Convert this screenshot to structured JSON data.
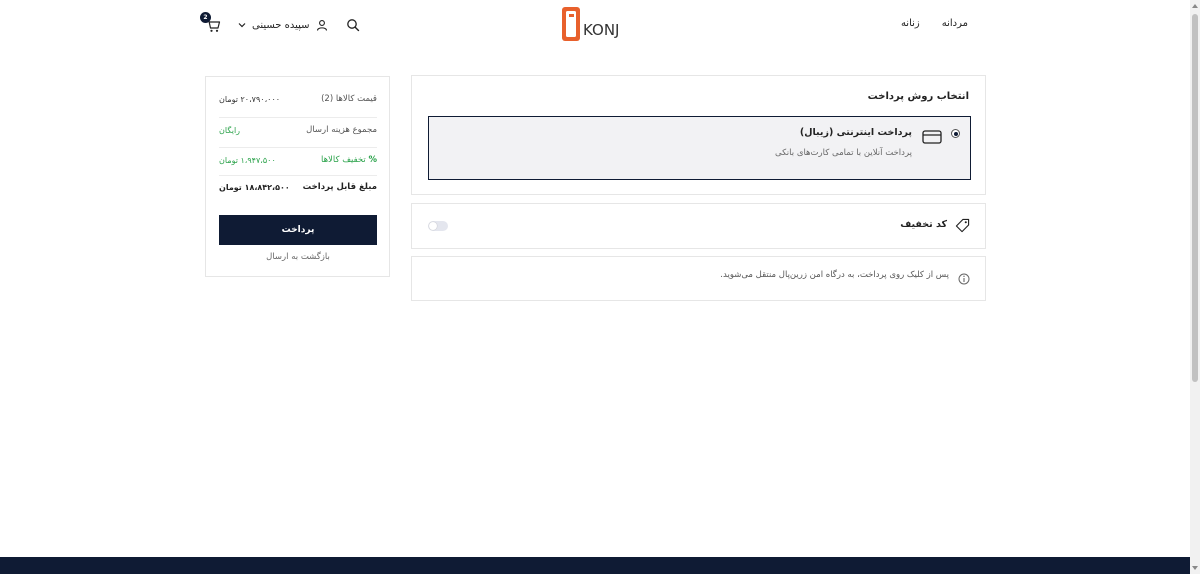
{
  "header": {
    "nav": [
      {
        "label": "مردانه"
      },
      {
        "label": "زنانه"
      }
    ],
    "logo_text": "KONJ",
    "user_name": "سپیده حسینی",
    "cart_count": "2"
  },
  "summary": {
    "items_price_label": "قیمت کالاها (2)",
    "items_price_value": "۲۰،۷۹۰،۰۰۰ تومان",
    "shipping_label": "مجموع هزینه ارسال",
    "shipping_value": "رایگان",
    "discount_label": "تخفیف کالاها",
    "discount_value": "۱،۹۴۷،۵۰۰ تومان",
    "payable_label": "مبلغ قابل پرداخت",
    "payable_value": "۱۸،۸۴۲،۵۰۰ تومان",
    "pay_button": "پرداخت",
    "back_link": "بازگشت به ارسال"
  },
  "payment": {
    "title": "انتخاب روش پرداخت",
    "method_title": "پرداخت اینترنتی (زیبال)",
    "method_sub": "پرداخت آنلاین با تمامی کارت‌های بانکی"
  },
  "discount": {
    "label": "کد تخفیف"
  },
  "info": {
    "text": "پس از کلیک روی پرداخت، به درگاه امن زرین‌پال منتقل می‌شوید."
  },
  "colors": {
    "primary": "#0f1b34",
    "accent": "#e8602c",
    "success": "#2aa24a"
  }
}
